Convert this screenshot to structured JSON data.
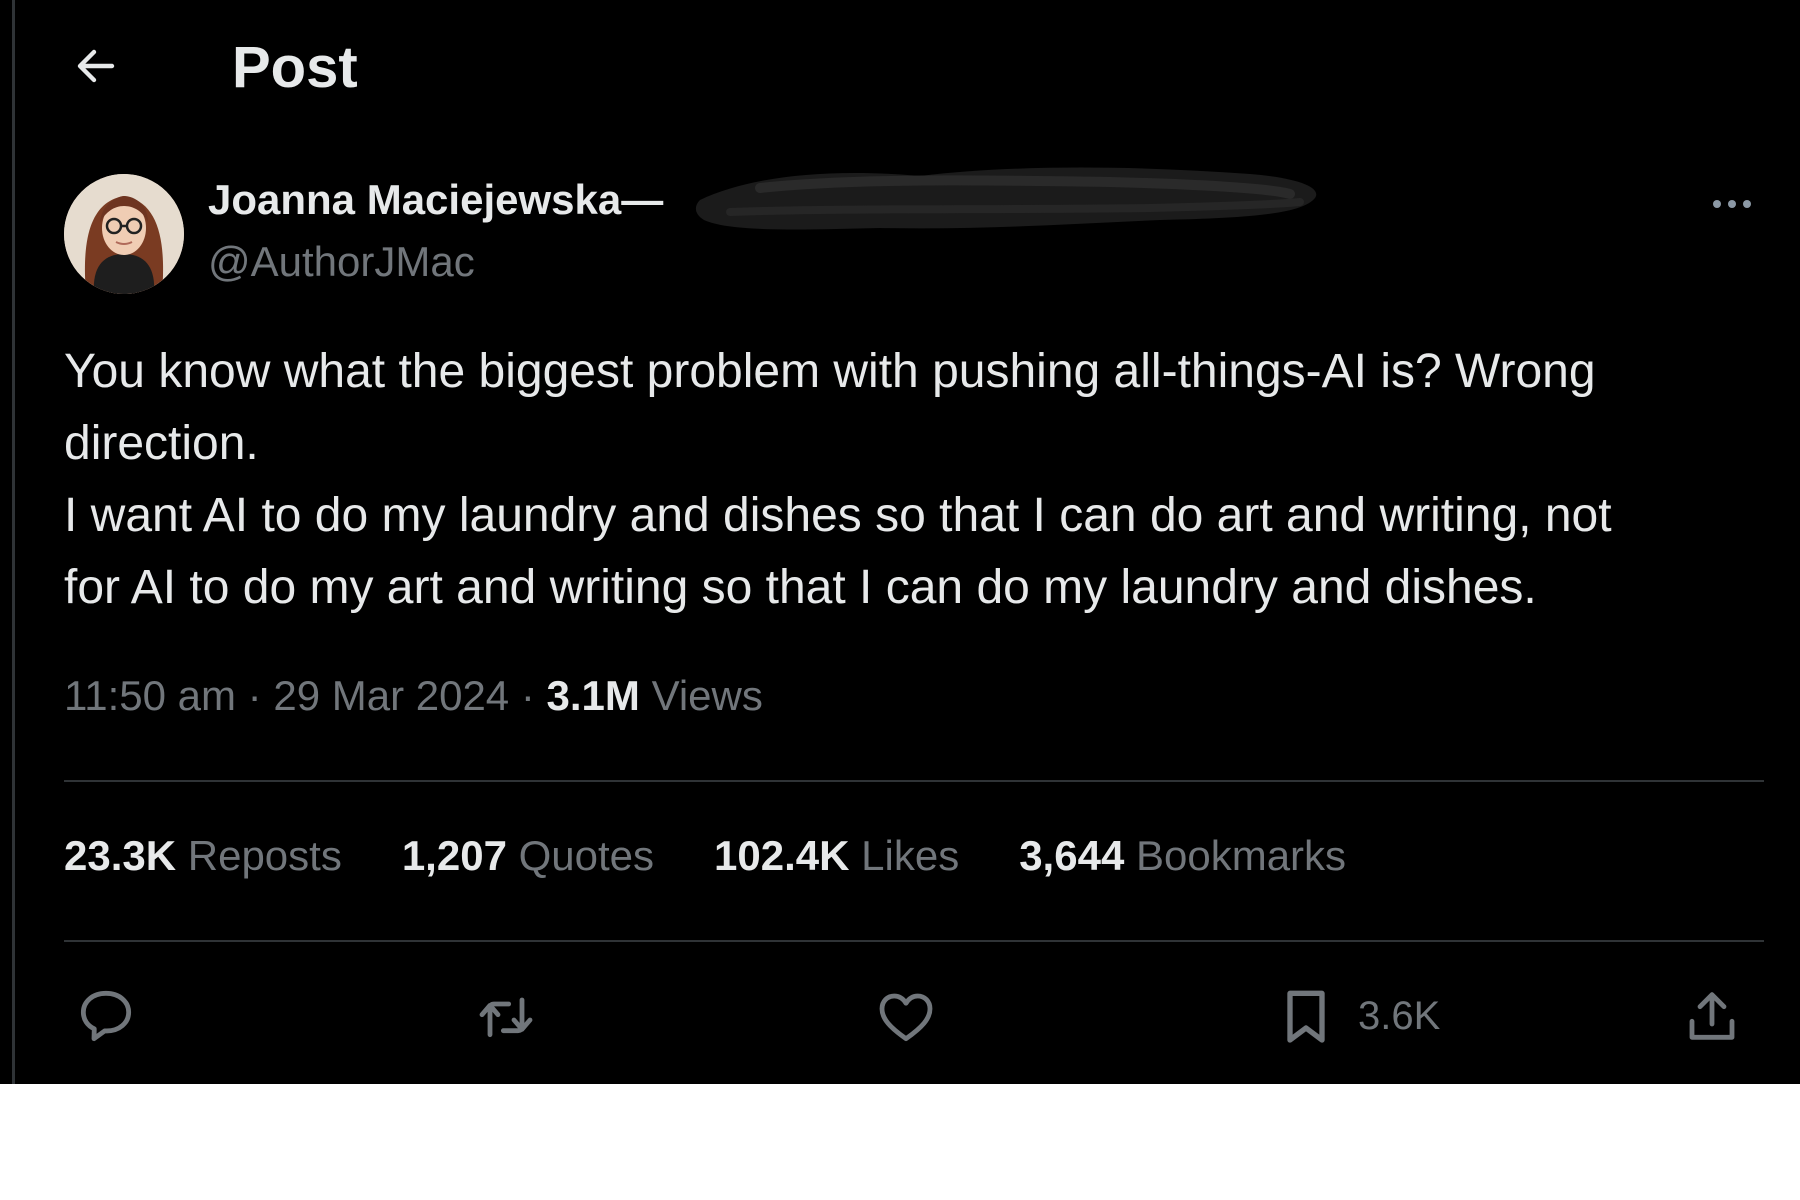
{
  "header": {
    "title": "Post"
  },
  "post": {
    "author_name": "Joanna Maciejewska—",
    "author_handle": "@AuthorJMac",
    "text_lines": [
      "You know what the biggest problem with pushing all-things-AI is? Wrong",
      "direction.",
      "I want AI to do my laundry and dishes so that I can do art and writing, not",
      "for AI to do my art and writing so that I can do my laundry and dishes."
    ],
    "time": "11:50 am",
    "date": "29 Mar 2024",
    "views_count": "3.1M",
    "views_label": "Views",
    "separator": "·"
  },
  "stats": {
    "reposts_count": "23.3K",
    "reposts_label": "Reposts",
    "quotes_count": "1,207",
    "quotes_label": "Quotes",
    "likes_count": "102.4K",
    "likes_label": "Likes",
    "bookmarks_count": "3,644",
    "bookmarks_label": "Bookmarks"
  },
  "actions": {
    "bookmark_count": "3.6K"
  },
  "colors": {
    "background": "#000000",
    "primary_text": "#e7e9ea",
    "secondary_text": "#71767b",
    "divider": "#2f3336"
  },
  "icons": {
    "back": "arrow-left-icon",
    "more": "more-horizontal-icon",
    "reply": "speech-bubble-icon",
    "repost": "repost-arrows-icon",
    "like": "heart-icon",
    "bookmark": "bookmark-icon",
    "share": "share-upload-icon"
  }
}
